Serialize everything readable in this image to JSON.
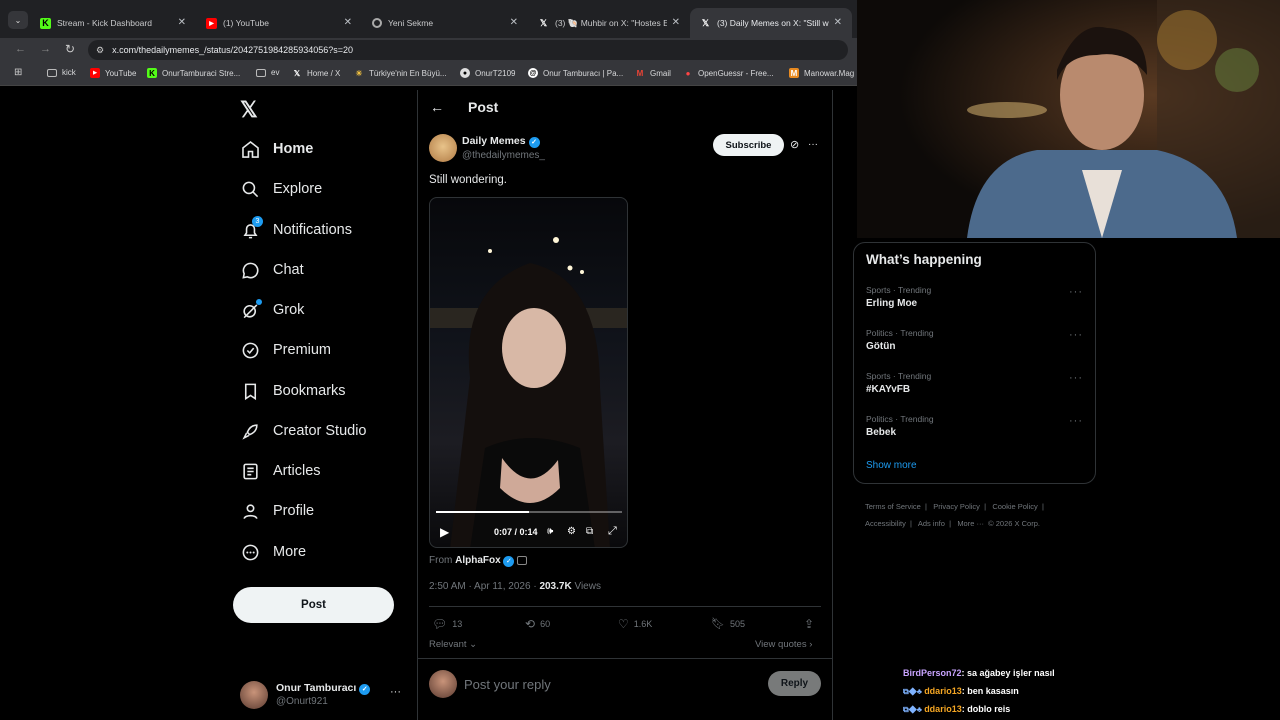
{
  "browser": {
    "tabs": [
      {
        "title": "Stream - Kick Dashboard",
        "favicon": "kick-icon"
      },
      {
        "title": "(1) YouTube",
        "favicon": "youtube-icon"
      },
      {
        "title": "Yeni Sekme",
        "favicon": "chrome-icon"
      },
      {
        "title": "(3) 🐚 Muhbir on X: \"Hostes Es",
        "favicon": "x-icon"
      },
      {
        "title": "(3) Daily Memes on X: \"Still wo",
        "favicon": "x-icon"
      }
    ],
    "url": "x.com/thedailymemes_/status/2042751984285934056?s=20",
    "bookmarks": [
      "kick",
      "YouTube",
      "OnurTamburaci Stre...",
      "ev",
      "Home / X",
      "Türkiye'nin En Büyü...",
      "OnurT2109",
      "Onur Tamburacı | Pa...",
      "Gmail",
      "OpenGuessr - Free...",
      "Manowar.Mag"
    ]
  },
  "nav": {
    "items": [
      "Home",
      "Explore",
      "Notifications",
      "Chat",
      "Grok",
      "Premium",
      "Bookmarks",
      "Creator Studio",
      "Articles",
      "Profile",
      "More"
    ],
    "notif_badge": "3",
    "post_button": "Post",
    "user_name": "Onur Tamburacı",
    "user_handle": "@Onurt921"
  },
  "post": {
    "header": "Post",
    "author": "Daily Memes",
    "handle": "@thedailymemes_",
    "subscribe": "Subscribe",
    "text": "Still wondering.",
    "video_time": "0:07 / 0:14",
    "video_progress": 0.5,
    "from_label": "From",
    "from_name": "AlphaFox",
    "timestamp": "2:50 AM · Apr 11, 2026 ·",
    "views_count": "203.7K",
    "views_label": "Views",
    "replies": "13",
    "reposts": "60",
    "likes": "1.6K",
    "bookmarks": "505",
    "relevant": "Relevant",
    "view_quotes": "View quotes",
    "reply_placeholder": "Post your reply",
    "reply_button": "Reply"
  },
  "trending": {
    "title": "What’s happening",
    "items": [
      {
        "category": "Sports · Trending",
        "name": "Erling Moe"
      },
      {
        "category": "Politics · Trending",
        "name": "Götün"
      },
      {
        "category": "Sports · Trending",
        "name": "#KAYvFB"
      },
      {
        "category": "Politics · Trending",
        "name": "Bebek"
      }
    ],
    "show_more": "Show more"
  },
  "footer": [
    "Terms of Service",
    "|",
    "Privacy Policy",
    "|",
    "Cookie Policy",
    "|",
    "Accessibility",
    "|",
    "Ads info",
    "|",
    "More ···",
    "© 2026 X Corp."
  ],
  "chat": [
    {
      "user": "BirdPerson72",
      "msg": ": sa ağabey işler nasıl",
      "color": "#c9a4ff"
    },
    {
      "user": "ddario13",
      "msg": ": ben kasasın",
      "color": "#f5a623"
    },
    {
      "user": "ddario13",
      "msg": ": doblo reis",
      "color": "#f5a623"
    }
  ],
  "colors": {
    "accent": "#1d9bf0",
    "bg": "#000000",
    "border": "#2f3336"
  }
}
